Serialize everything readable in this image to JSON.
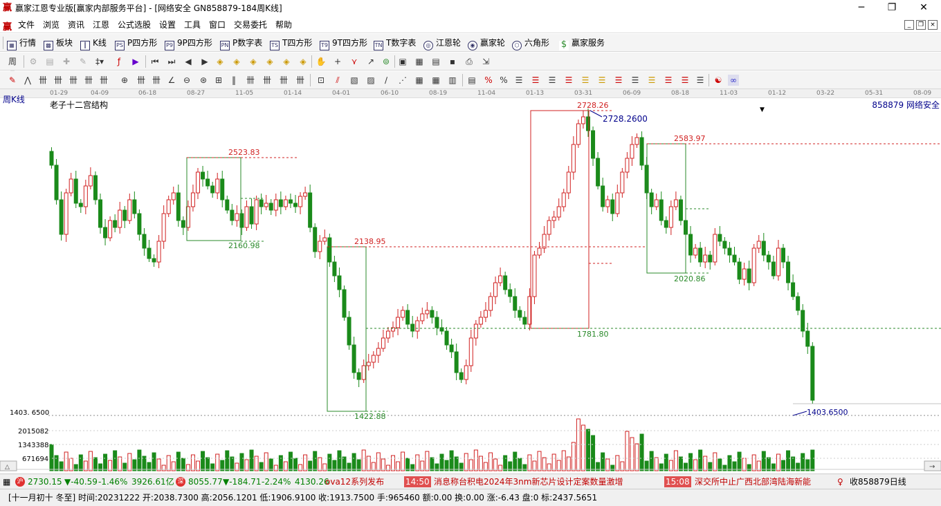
{
  "window": {
    "title": "赢家江恩专业版[赢家内部服务平台] - [网络安全  GN858879-184周K线]",
    "minimize": "─",
    "maximize": "❐",
    "close": "✕"
  },
  "menu": {
    "items": [
      "文件",
      "浏览",
      "资讯",
      "江恩",
      "公式选股",
      "设置",
      "工具",
      "窗口",
      "交易委托",
      "帮助"
    ]
  },
  "toolbar1": {
    "items": [
      {
        "label": "行情",
        "icon": "grid-icon"
      },
      {
        "label": "板块",
        "icon": "blocks-icon"
      },
      {
        "label": "K线",
        "icon": "candle-icon"
      },
      {
        "label": "P四方形",
        "icon": "PS"
      },
      {
        "label": "9P四方形",
        "icon": "P9"
      },
      {
        "label": "P数字表",
        "icon": "PN"
      },
      {
        "label": "T四方形",
        "icon": "TS"
      },
      {
        "label": "9T四方形",
        "icon": "T9"
      },
      {
        "label": "T数字表",
        "icon": "TN"
      },
      {
        "label": "江恩轮",
        "icon": "wheel-icon"
      },
      {
        "label": "赢家轮",
        "icon": "wheel2-icon"
      },
      {
        "label": "六角形",
        "icon": "hexagon-icon"
      },
      {
        "label": "赢家服务",
        "icon": "dollar-icon"
      }
    ]
  },
  "chart": {
    "period_label": "周K线",
    "indicator_name": "老子十二宫结构",
    "code_label": "858879 网络安全",
    "dates": [
      "01-29",
      "04-09",
      "06-18",
      "08-27",
      "11-05",
      "01-14",
      "04-01",
      "06-10",
      "08-19",
      "11-04",
      "01-13",
      "03-31",
      "06-09",
      "08-18",
      "11-03",
      "01-12",
      "03-22",
      "05-31",
      "08-09"
    ],
    "price_labels": {
      "p2523": "2523.83",
      "p2160": "2160.98",
      "p2138": "2138.95",
      "p1422": "1422.88",
      "p2728": "2728.26",
      "p2728b": "2728.2600",
      "p1781": "1781.80",
      "p2583": "2583.97",
      "p2020": "2020.86",
      "p1403": "1403.6500"
    },
    "axis_labels": {
      "y_low": "1403. 6500",
      "vol1": "2015082",
      "vol2": "1343388",
      "vol3": "671694"
    }
  },
  "chart_data": {
    "type": "candlestick",
    "title": "老子十二宫结构",
    "marked_levels": [
      2523.83,
      2160.98,
      2138.95,
      1422.88,
      2728.26,
      1781.8,
      2583.97,
      2020.86,
      1403.65
    ],
    "ylim": [
      1403.65,
      2728.26
    ],
    "volume_ticks": [
      2015082,
      1343388,
      671694
    ]
  },
  "status1": {
    "index1_value": "2730.15",
    "index1_change": "▼-40.59",
    "index1_pct": "-1.46%",
    "index1_amount": "3926.61亿",
    "index2_value": "8055.77",
    "index2_change": "▼-184.71",
    "index2_pct": "-2.24%",
    "index2_amount": "4130.26",
    "news1": "ova12系列发布",
    "news2_time": "14:50",
    "news2": "消息称台积电2024年3nm新芯片设计定案数量激增",
    "news3_time": "15:08",
    "news3": "深交所中止广西北部湾陆海新能",
    "right_label": "收858879日线"
  },
  "status2": {
    "text": "[十一月初十 冬至] 时间:20231222 开:2038.7300 高:2056.1201 低:1906.9100 收:1913.7500 手:965460 额:0.00 换:0.00 涨:-6.43 盘:0 标:2437.5651"
  }
}
